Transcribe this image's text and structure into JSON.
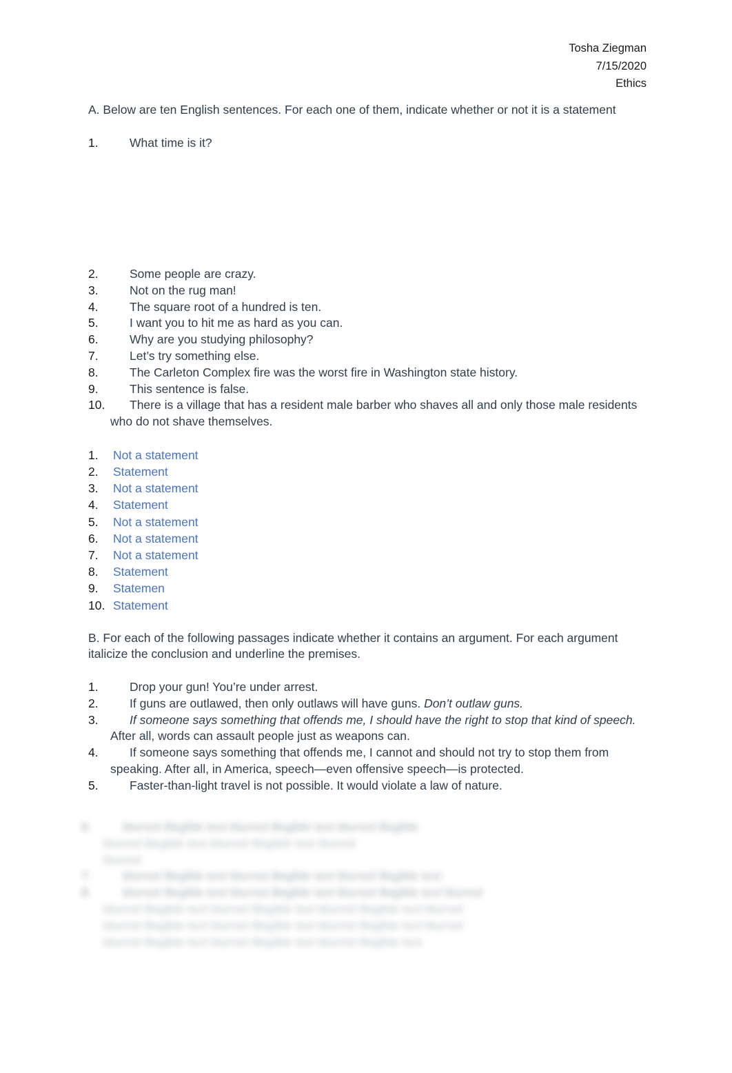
{
  "document": {
    "header": {
      "author": "Tosha Ziegman",
      "date": "7/15/2020",
      "course": "Ethics"
    },
    "section_a": {
      "prompt": "A. Below are ten English sentences. For each one of them, indicate whether or not it is a statement",
      "items": [
        {
          "num": "1.",
          "text": "What time is it?"
        },
        {
          "num": "2.",
          "text": "Some people are crazy."
        },
        {
          "num": "3.",
          "text": "Not on the rug man!"
        },
        {
          "num": "4.",
          "text": "The square root of a hundred is ten."
        },
        {
          "num": "5.",
          "text": "I want you to hit me as hard as you can."
        },
        {
          "num": "6.",
          "text": "Why are you studying philosophy?"
        },
        {
          "num": "7.",
          "text": "Let’s try something else."
        },
        {
          "num": "8.",
          "text": "The Carleton Complex fire was the worst fire in Washington state history."
        },
        {
          "num": "9.",
          "text": "This sentence is false."
        },
        {
          "num": "10.",
          "text": "There is a village that has a resident male barber who shaves all and only those male residents who do not shave themselves."
        }
      ],
      "answers": [
        {
          "num": "1.",
          "text": "Not a statement"
        },
        {
          "num": "2.",
          "text": "Statement"
        },
        {
          "num": "3.",
          "text": "Not a statement"
        },
        {
          "num": "4.",
          "text": "Statement"
        },
        {
          "num": "5.",
          "text": "Not a statement"
        },
        {
          "num": "6.",
          "text": "Not a statement"
        },
        {
          "num": "7.",
          "text": "Not a statement"
        },
        {
          "num": "8.",
          "text": "Statement"
        },
        {
          "num": "9.",
          "text": "Statemen"
        },
        {
          "num": "10.",
          "text": "Statement"
        }
      ],
      "answer_color": "#4a72c4"
    },
    "section_b": {
      "prompt": "B. For each of the following passages indicate whether it contains an argument. For each argument italicize the conclusion and underline the premises.",
      "items": [
        {
          "num": "1.",
          "plain_before": "Drop your gun! You’re under arrest.",
          "italic": "",
          "plain_after": ""
        },
        {
          "num": "2.",
          "plain_before": "If guns are outlawed, then only outlaws will have guns. ",
          "italic": "Don’t outlaw guns.",
          "plain_after": ""
        },
        {
          "num": "3.",
          "plain_before": "",
          "italic": "If someone says something that offends me, I should have the right to stop that kind of speech.",
          "plain_after": " After all, words can assault people just as weapons can."
        },
        {
          "num": "4.",
          "plain_before": "If someone says something that offends me, I cannot and should not try to stop them from speaking. After all, in America, speech—even offensive speech—is protected.",
          "italic": "",
          "plain_after": ""
        },
        {
          "num": "5.",
          "plain_before": "Faster-than-light travel is not possible. It would violate a law of nature.",
          "italic": "",
          "plain_after": ""
        }
      ],
      "obscured_items": [
        {
          "num": "6.",
          "text": "blurred illegible text blurred illegible text blurred illegible"
        },
        {
          "num": "",
          "text": "blurred illegible text blurred illegible text blurred"
        },
        {
          "num": "",
          "text": "blurred"
        },
        {
          "num": "7.",
          "text": "blurred illegible text blurred illegible text blurred illegible text"
        },
        {
          "num": "8.",
          "text": "blurred illegible text blurred illegible text blurred illegible text blurred"
        },
        {
          "num": "",
          "text": "blurred illegible text blurred illegible text blurred illegible text blurred"
        },
        {
          "num": "",
          "text": "blurred illegible text blurred illegible text blurred illegible text blurred"
        },
        {
          "num": "",
          "text": "blurred illegible text blurred illegible text blurred illegible text"
        }
      ]
    }
  }
}
